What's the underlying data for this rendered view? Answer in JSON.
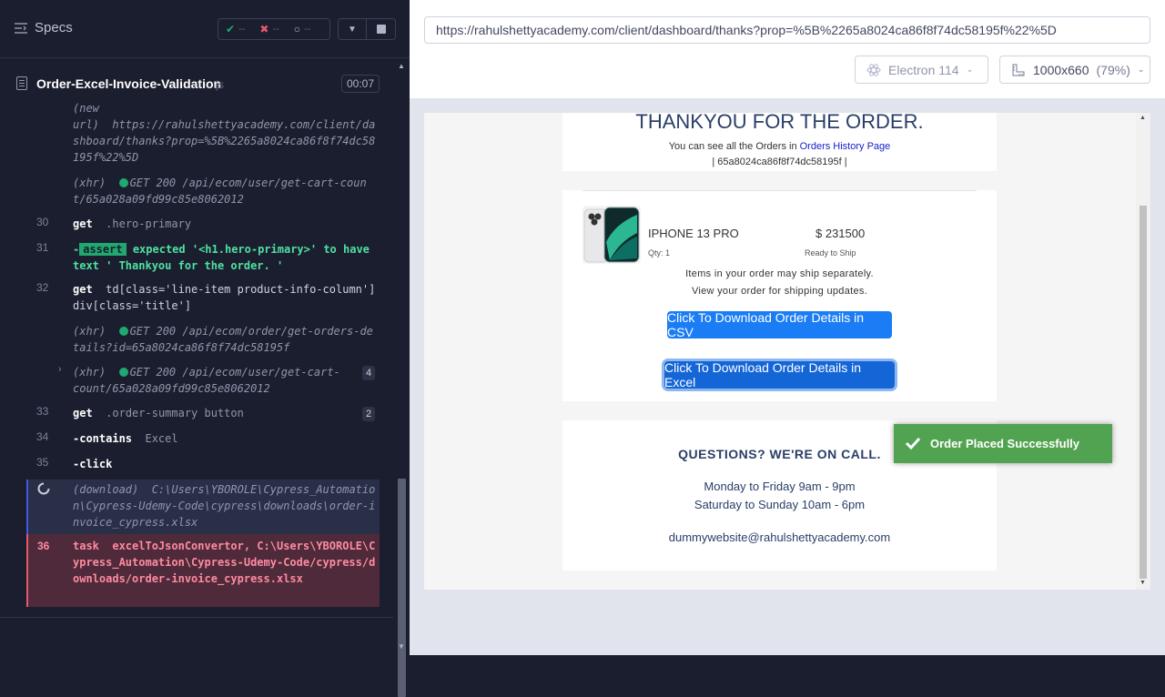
{
  "sidebar": {
    "specs_label": "Specs",
    "stats": {
      "passed": "--",
      "failed": "--",
      "pending": "--"
    },
    "spec_title": "Order-Excel-Invoice-Validation",
    "spec_ext": ".js",
    "timer": "00:07"
  },
  "commands": {
    "c0": {
      "text": "(new\nurl)  https://rahulshettyacademy.com/client/dashboard/thanks?prop=%5B%2265a8024ca86f8f74dc58195f%22%5D"
    },
    "c1": {
      "pre": "(xhr)  ",
      "text": "GET 200 /api/ecom/user/get-cart-count/65a028a09fd99c85e8062012"
    },
    "c2": {
      "num": "30",
      "name": "get",
      "arg": ".hero-primary"
    },
    "c3": {
      "num": "31",
      "tag": "assert",
      "text": " expected '<h1.hero-primary>' to have text ' Thankyou for the order. '"
    },
    "c4": {
      "num": "32",
      "name": "get",
      "arg": "td[class='line-item product-info-column'] div[class='title']"
    },
    "c5": {
      "pre": "(xhr)  ",
      "text": "GET 200 /api/ecom/order/get-orders-details?id=65a8024ca86f8f74dc58195f"
    },
    "c6": {
      "pre": "(xhr)  ",
      "text": "GET 200 /api/ecom/user/get-cart-count/65a028a09fd99c85e8062012",
      "badge": "4"
    },
    "c7": {
      "num": "33",
      "name": "get",
      "arg": ".order-summary button",
      "badge": "2"
    },
    "c8": {
      "num": "34",
      "name": "-contains",
      "arg": "Excel"
    },
    "c9": {
      "num": "35",
      "name": "-click"
    },
    "c10": {
      "pre": "(download)  ",
      "text": "C:\\Users\\YBOROLE\\Cypress_Automation\\Cypress-Udemy-Code\\cypress\\downloads\\order-invoice_cypress.xlsx"
    },
    "c11": {
      "num": "36",
      "name": "task",
      "text": "excelToJsonConvertor, C:\\Users\\YBOROLE\\Cypress_Automation\\Cypress-Udemy-Code/cypress/downloads/order-invoice_cypress.xlsx"
    }
  },
  "toolbar": {
    "url": "https://rahulshettyacademy.com/client/dashboard/thanks?prop=%5B%2265a8024ca86f8f74dc58195f%22%5D",
    "browser": "Electron 114",
    "viewport": "1000x660",
    "zoom": "(79%)"
  },
  "app": {
    "thanks_title": "THANKYOU FOR THE ORDER.",
    "orders_line_pre": "You can see all the Orders in ",
    "orders_link": "Orders History Page",
    "order_id": "| 65a8024ca86f8f74dc58195f |",
    "product_name": "IPHONE 13 PRO",
    "product_price": "$ 231500",
    "qty": "Qty: 1",
    "status": "Ready to Ship",
    "note1": "Items in your order may ship separately.",
    "note2": "View your order for shipping updates.",
    "btn_csv": "Click To Download Order Details in CSV",
    "btn_excel": "Click To Download Order Details in Excel",
    "questions_title": "QUESTIONS? WE'RE ON CALL.",
    "hours1": "Monday to Friday 9am - 9pm",
    "hours2": "Saturday to Sunday 10am - 6pm",
    "email": "dummywebsite@rahulshettyacademy.com",
    "toast": "Order Placed Successfully"
  },
  "colors": {
    "pass": "#1fa971",
    "fail": "#e45770",
    "brand_button": "#1a7df5",
    "toast": "#51a351"
  }
}
